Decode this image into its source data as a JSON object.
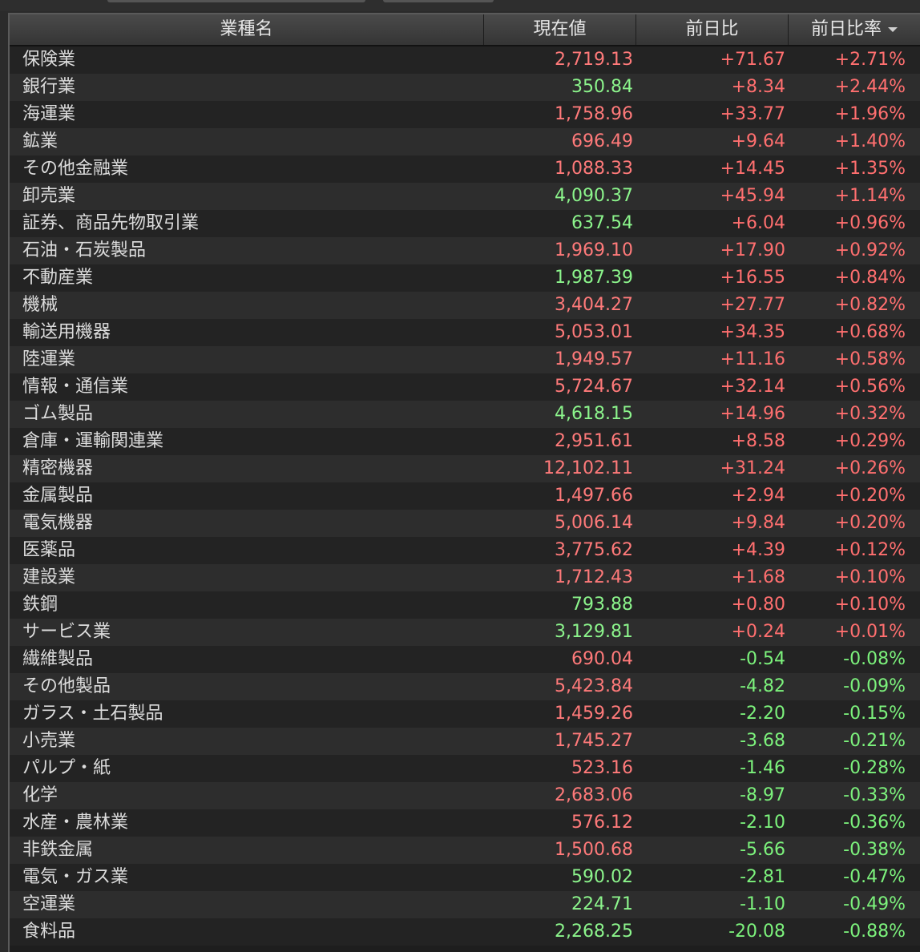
{
  "colors": {
    "up": "#ff6f6f",
    "down": "#7cf27c"
  },
  "header": {
    "sector": "業種名",
    "price": "現在値",
    "change": "前日比",
    "change_rate": "前日比率",
    "sort_icon": "triangle-down-icon"
  },
  "rows": [
    {
      "name": "保険業",
      "price": "2,719.13",
      "price_dir": "up",
      "change": "+71.67",
      "rate": "+2.71%"
    },
    {
      "name": "銀行業",
      "price": "350.84",
      "price_dir": "down",
      "change": "+8.34",
      "rate": "+2.44%"
    },
    {
      "name": "海運業",
      "price": "1,758.96",
      "price_dir": "up",
      "change": "+33.77",
      "rate": "+1.96%"
    },
    {
      "name": "鉱業",
      "price": "696.49",
      "price_dir": "up",
      "change": "+9.64",
      "rate": "+1.40%"
    },
    {
      "name": "その他金融業",
      "price": "1,088.33",
      "price_dir": "up",
      "change": "+14.45",
      "rate": "+1.35%"
    },
    {
      "name": "卸売業",
      "price": "4,090.37",
      "price_dir": "down",
      "change": "+45.94",
      "rate": "+1.14%"
    },
    {
      "name": "証券、商品先物取引業",
      "price": "637.54",
      "price_dir": "down",
      "change": "+6.04",
      "rate": "+0.96%"
    },
    {
      "name": "石油・石炭製品",
      "price": "1,969.10",
      "price_dir": "up",
      "change": "+17.90",
      "rate": "+0.92%"
    },
    {
      "name": "不動産業",
      "price": "1,987.39",
      "price_dir": "down",
      "change": "+16.55",
      "rate": "+0.84%"
    },
    {
      "name": "機械",
      "price": "3,404.27",
      "price_dir": "up",
      "change": "+27.77",
      "rate": "+0.82%"
    },
    {
      "name": "輸送用機器",
      "price": "5,053.01",
      "price_dir": "up",
      "change": "+34.35",
      "rate": "+0.68%"
    },
    {
      "name": "陸運業",
      "price": "1,949.57",
      "price_dir": "up",
      "change": "+11.16",
      "rate": "+0.58%"
    },
    {
      "name": "情報・通信業",
      "price": "5,724.67",
      "price_dir": "up",
      "change": "+32.14",
      "rate": "+0.56%"
    },
    {
      "name": "ゴム製品",
      "price": "4,618.15",
      "price_dir": "down",
      "change": "+14.96",
      "rate": "+0.32%"
    },
    {
      "name": "倉庫・運輸関連業",
      "price": "2,951.61",
      "price_dir": "up",
      "change": "+8.58",
      "rate": "+0.29%"
    },
    {
      "name": "精密機器",
      "price": "12,102.11",
      "price_dir": "up",
      "change": "+31.24",
      "rate": "+0.26%"
    },
    {
      "name": "金属製品",
      "price": "1,497.66",
      "price_dir": "up",
      "change": "+2.94",
      "rate": "+0.20%"
    },
    {
      "name": "電気機器",
      "price": "5,006.14",
      "price_dir": "up",
      "change": "+9.84",
      "rate": "+0.20%"
    },
    {
      "name": "医薬品",
      "price": "3,775.62",
      "price_dir": "up",
      "change": "+4.39",
      "rate": "+0.12%"
    },
    {
      "name": "建設業",
      "price": "1,712.43",
      "price_dir": "up",
      "change": "+1.68",
      "rate": "+0.10%"
    },
    {
      "name": "鉄鋼",
      "price": "793.88",
      "price_dir": "down",
      "change": "+0.80",
      "rate": "+0.10%"
    },
    {
      "name": "サービス業",
      "price": "3,129.81",
      "price_dir": "down",
      "change": "+0.24",
      "rate": "+0.01%"
    },
    {
      "name": "繊維製品",
      "price": "690.04",
      "price_dir": "up",
      "change": "-0.54",
      "rate": "-0.08%"
    },
    {
      "name": "その他製品",
      "price": "5,423.84",
      "price_dir": "up",
      "change": "-4.82",
      "rate": "-0.09%"
    },
    {
      "name": "ガラス・土石製品",
      "price": "1,459.26",
      "price_dir": "up",
      "change": "-2.20",
      "rate": "-0.15%"
    },
    {
      "name": "小売業",
      "price": "1,745.27",
      "price_dir": "up",
      "change": "-3.68",
      "rate": "-0.21%"
    },
    {
      "name": "パルプ・紙",
      "price": "523.16",
      "price_dir": "up",
      "change": "-1.46",
      "rate": "-0.28%"
    },
    {
      "name": "化学",
      "price": "2,683.06",
      "price_dir": "up",
      "change": "-8.97",
      "rate": "-0.33%"
    },
    {
      "name": "水産・農林業",
      "price": "576.12",
      "price_dir": "up",
      "change": "-2.10",
      "rate": "-0.36%"
    },
    {
      "name": "非鉄金属",
      "price": "1,500.68",
      "price_dir": "up",
      "change": "-5.66",
      "rate": "-0.38%"
    },
    {
      "name": "電気・ガス業",
      "price": "590.02",
      "price_dir": "down",
      "change": "-2.81",
      "rate": "-0.47%"
    },
    {
      "name": "空運業",
      "price": "224.71",
      "price_dir": "down",
      "change": "-1.10",
      "rate": "-0.49%"
    },
    {
      "name": "食料品",
      "price": "2,268.25",
      "price_dir": "down",
      "change": "-20.08",
      "rate": "-0.88%"
    }
  ]
}
